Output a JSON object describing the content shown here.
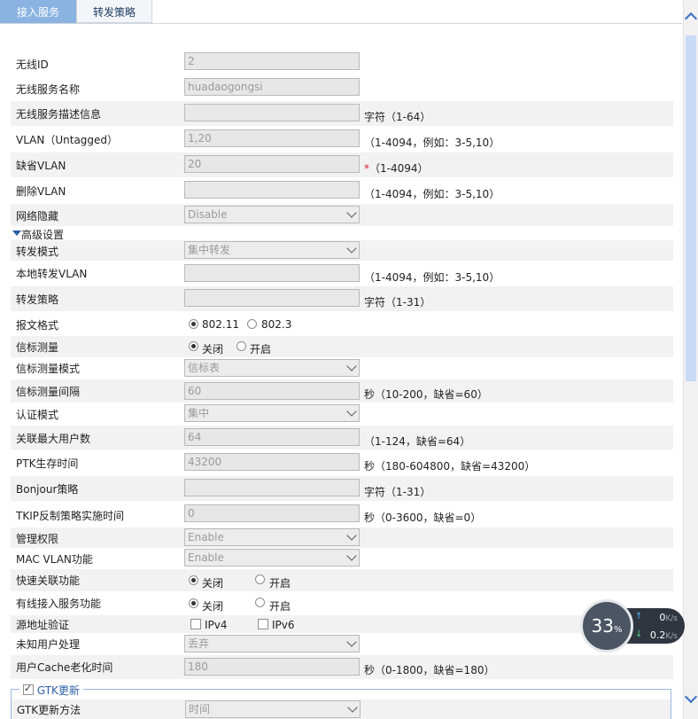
{
  "tabs": {
    "access": "接入服务",
    "forward": "转发策略"
  },
  "fields": {
    "wireless_id": {
      "label": "无线ID",
      "value": "2"
    },
    "service_name": {
      "label": "无线服务名称",
      "value": "huadaogongsi"
    },
    "service_desc": {
      "label": "无线服务描述信息",
      "value": "",
      "hint": "字符（1-64）"
    },
    "vlan_untagged": {
      "label": "VLAN（Untagged）",
      "value": "1,20",
      "hint": "（1-4094，例如：3-5,10）"
    },
    "default_vlan": {
      "label": "缺省VLAN",
      "value": "20",
      "required": "*",
      "hint": "（1-4094）"
    },
    "delete_vlan": {
      "label": "删除VLAN",
      "value": "",
      "hint": "（1-4094，例如：3-5,10）"
    },
    "network_hide": {
      "label": "网络隐藏",
      "value": "Disable"
    }
  },
  "advanced": {
    "title": "高级设置",
    "forward_mode": {
      "label": "转发模式",
      "value": "集中转发"
    },
    "local_vlan": {
      "label": "本地转发VLAN",
      "value": "",
      "hint": "（1-4094，例如：3-5,10）"
    },
    "forward_policy": {
      "label": "转发策略",
      "value": "",
      "hint": "字符（1-31）"
    },
    "frame_format": {
      "label": "报文格式",
      "opt1": "802.11",
      "opt2": "802.3"
    },
    "beacon_measure": {
      "label": "信标测量",
      "opt1": "关闭",
      "opt2": "开启"
    },
    "beacon_mode": {
      "label": "信标测量模式",
      "value": "信标表"
    },
    "beacon_interval": {
      "label": "信标测量间隔",
      "value": "60",
      "hint": "秒（10-200，缺省=60）"
    },
    "auth_mode": {
      "label": "认证模式",
      "value": "集中"
    },
    "max_users": {
      "label": "关联最大用户数",
      "value": "64",
      "hint": "（1-124，缺省=64）"
    },
    "ptk_lifetime": {
      "label": "PTK生存时间",
      "value": "43200",
      "hint": "秒（180-604800，缺省=43200）"
    },
    "bonjour": {
      "label": "Bonjour策略",
      "value": "",
      "hint": "字符（1-31）"
    },
    "tkip": {
      "label": "TKIP反制策略实施时间",
      "value": "0",
      "hint": "秒（0-3600，缺省=0）"
    },
    "mgmt": {
      "label": "管理权限",
      "value": "Enable"
    },
    "mac_vlan": {
      "label": "MAC VLAN功能",
      "value": "Enable"
    },
    "fast_assoc": {
      "label": "快速关联功能",
      "opt1": "关闭",
      "opt2": "开启"
    },
    "wired_access": {
      "label": "有线接入服务功能",
      "opt1": "关闭",
      "opt2": "开启"
    },
    "src_verify": {
      "label": "源地址验证",
      "opt1": "IPv4",
      "opt2": "IPv6"
    },
    "unknown_user": {
      "label": "未知用户处理",
      "value": "丢弃"
    },
    "cache_age": {
      "label": "用户Cache老化时间",
      "value": "180",
      "hint": "秒（0-1800，缺省=180）"
    }
  },
  "gtk": {
    "title": "GTK更新",
    "method_label": "GTK更新方法",
    "method_value": "时间"
  },
  "widget": {
    "percent": "33",
    "percent_unit": "%",
    "up": "0",
    "down": "0.2",
    "unit": "K/s"
  }
}
